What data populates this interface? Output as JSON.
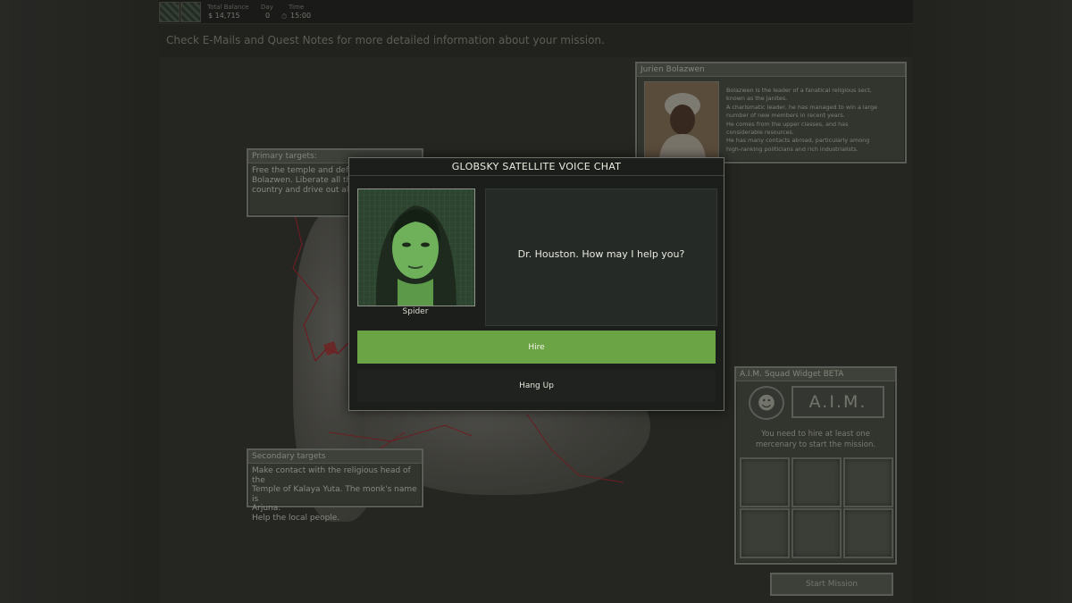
{
  "topbar": {
    "balance_label": "Total Balance",
    "balance_value": "$ 14,715",
    "day_label": "Day",
    "day_value": "0",
    "time_label": "Time",
    "time_value": "15:00"
  },
  "instructions": "Check E-Mails and Quest Notes for more detailed information about your mission.",
  "bio_panel": {
    "title": "Jurien Bolazwen",
    "lines": [
      "Bolazwen is the leader of a fanatical religious sect,",
      "known as the Janites.",
      "A charismatic leader, he has managed to win a large",
      "number of new members in recent years.",
      "He comes from the upper classes, and has",
      "considerable resources.",
      "He has many contacts abroad, particularly among",
      "high-ranking politicians and rich industrialists."
    ]
  },
  "primary_targets": {
    "title": "Primary targets:",
    "lines": [
      "Free the temple and defeat Jurien",
      "Bolazwen. Liberate all the",
      "country and drive out all th"
    ]
  },
  "secondary_targets": {
    "title": "Secondary targets",
    "lines": [
      "Make contact with the religious head of the",
      "Temple of Kalaya Yuta. The monk's name is",
      "Arjuna.",
      "Help the local people."
    ]
  },
  "aim_widget": {
    "title": "A.I.M. Squad Widget BETA",
    "logo_text": "A.I.M.",
    "message_lines": [
      "You need to hire at least one",
      "mercenary to start the mission."
    ],
    "start_button": "Start Mission"
  },
  "dialog": {
    "title": "GLOBSKY SATELLITE VOICE CHAT",
    "speaker": "Spider",
    "message": "Dr. Houston. How may I help you?",
    "hire_label": "Hire",
    "hangup_label": "Hang Up"
  },
  "colors": {
    "hire_green": "#6aa444",
    "panel_border": "#9ba096",
    "route_red": "#b8323a"
  }
}
